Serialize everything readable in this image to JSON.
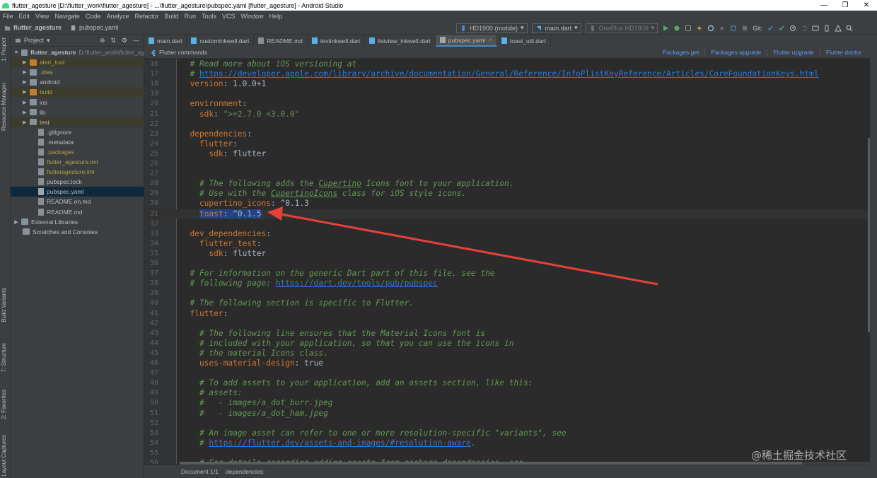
{
  "window": {
    "title": "flutter_agesture [D:\\flutter_work\\flutter_agesture] - ...\\flutter_agesture\\pubspec.yaml [flutter_agesture] - Android Studio"
  },
  "menu": [
    "File",
    "Edit",
    "View",
    "Navigate",
    "Code",
    "Analyze",
    "Refactor",
    "Build",
    "Run",
    "Tools",
    "VCS",
    "Window",
    "Help"
  ],
  "breadcrumb": {
    "project": "flutter_agesture",
    "file": "pubspec.yaml"
  },
  "toolbar": {
    "device_config": "HD1900 (mobile)",
    "run_config": "main.dart",
    "device": "OnePlus HD1900",
    "git_label": "Git:"
  },
  "left_strip": {
    "project": "1: Project",
    "resource_manager": "Resource Manager",
    "build_variants": "Build Variants",
    "structure": "7: Structure",
    "favorites": "2: Favorites",
    "layout_captures": "Layout Captures"
  },
  "project_panel": {
    "title": "Project",
    "tree": [
      {
        "label": "flutter_agesture",
        "path": "D:\\flutter_work\\flutter_ag",
        "indent": 0,
        "arrow": "▼",
        "icon": "folder",
        "bold": true
      },
      {
        "label": "alert_tool",
        "indent": 1,
        "arrow": "▶",
        "icon": "folder-orange",
        "olive": true,
        "hl": true
      },
      {
        "label": ".idea",
        "indent": 1,
        "arrow": "▶",
        "icon": "folder",
        "olive": true
      },
      {
        "label": "android",
        "indent": 1,
        "arrow": "▶",
        "icon": "folder"
      },
      {
        "label": "build",
        "indent": 1,
        "arrow": "▶",
        "icon": "folder-orange",
        "olive": true,
        "hl": true
      },
      {
        "label": "ios",
        "indent": 1,
        "arrow": "▶",
        "icon": "folder"
      },
      {
        "label": "lib",
        "indent": 1,
        "arrow": "▶",
        "icon": "folder"
      },
      {
        "label": "test",
        "indent": 1,
        "arrow": "▶",
        "icon": "folder",
        "hl": true
      },
      {
        "label": ".gitignore",
        "indent": 2,
        "icon": "file"
      },
      {
        "label": ".metadata",
        "indent": 2,
        "icon": "file"
      },
      {
        "label": ".packages",
        "indent": 2,
        "icon": "file",
        "olive": true
      },
      {
        "label": "flutter_agesture.iml",
        "indent": 2,
        "icon": "file",
        "olive": true
      },
      {
        "label": "flutteragesture.iml",
        "indent": 2,
        "icon": "file",
        "olive": true
      },
      {
        "label": "pubspec.lock",
        "indent": 2,
        "icon": "file"
      },
      {
        "label": "pubspec.yaml",
        "indent": 2,
        "icon": "file-yaml",
        "selected": true
      },
      {
        "label": "README.en.md",
        "indent": 2,
        "icon": "file"
      },
      {
        "label": "README.md",
        "indent": 2,
        "icon": "file"
      },
      {
        "label": "External Libraries",
        "indent": 0,
        "arrow": "▶",
        "icon": "folder"
      },
      {
        "label": "Scratches and Consoles",
        "indent": 0,
        "icon": "folder"
      }
    ]
  },
  "tabs": [
    {
      "label": "main.dart"
    },
    {
      "label": "custominkwell.dart"
    },
    {
      "label": "README.md"
    },
    {
      "label": "textinkwell.dart"
    },
    {
      "label": "listview_inkwell.dart"
    },
    {
      "label": "pubspec.yaml",
      "active": true
    },
    {
      "label": "toast_util.dart"
    }
  ],
  "flutter_commands": {
    "title": "Flutter commands",
    "links": [
      "Packages get",
      "Packages upgrade",
      "Flutter upgrade",
      "Flutter doctor"
    ]
  },
  "editor": {
    "lines": [
      {
        "n": "16",
        "parts": [
          {
            "t": "  # Read more about iOS versioning at",
            "c": "c"
          }
        ]
      },
      {
        "n": "17",
        "parts": [
          {
            "t": "  # ",
            "c": "c"
          },
          {
            "t": "https://developer.apple.com/library/archive/documentation/General/Reference/InfoPlistKeyReference/Articles/CoreFoundationKeys.html",
            "c": "u"
          }
        ]
      },
      {
        "n": "18",
        "parts": [
          {
            "t": "  version",
            "c": "k"
          },
          {
            "t": ": 1.0.0+1",
            "c": "v"
          }
        ]
      },
      {
        "n": "19",
        "parts": []
      },
      {
        "n": "20",
        "parts": [
          {
            "t": "  environment",
            "c": "k"
          },
          {
            "t": ":",
            "c": "v"
          }
        ]
      },
      {
        "n": "21",
        "parts": [
          {
            "t": "    sdk",
            "c": "k"
          },
          {
            "t": ": ",
            "c": "v"
          },
          {
            "t": "\">=2.7.0 <3.0.0\"",
            "c": "s"
          }
        ]
      },
      {
        "n": "22",
        "parts": []
      },
      {
        "n": "23",
        "parts": [
          {
            "t": "  dependencies",
            "c": "k"
          },
          {
            "t": ":",
            "c": "v"
          }
        ]
      },
      {
        "n": "24",
        "parts": [
          {
            "t": "    flutter",
            "c": "k"
          },
          {
            "t": ":",
            "c": "v"
          }
        ]
      },
      {
        "n": "25",
        "parts": [
          {
            "t": "      sdk",
            "c": "k"
          },
          {
            "t": ": flutter",
            "c": "v"
          }
        ]
      },
      {
        "n": "26",
        "parts": []
      },
      {
        "n": "27",
        "parts": []
      },
      {
        "n": "28",
        "parts": [
          {
            "t": "    # The following adds the ",
            "c": "c"
          },
          {
            "t": "Cupertino",
            "c": "cu"
          },
          {
            "t": " Icons font to your application.",
            "c": "c"
          }
        ]
      },
      {
        "n": "29",
        "parts": [
          {
            "t": "    # Use with the ",
            "c": "c"
          },
          {
            "t": "CupertinoIcons",
            "c": "cu"
          },
          {
            "t": " class for iOS style icons.",
            "c": "c"
          }
        ]
      },
      {
        "n": "30",
        "parts": [
          {
            "t": "    cupertino_icons",
            "c": "k"
          },
          {
            "t": ": ^0.1.3",
            "c": "v"
          }
        ]
      },
      {
        "n": "31",
        "current": true,
        "parts": [
          {
            "t": "    ",
            "c": "v"
          },
          {
            "t": "toast",
            "c": "ks"
          },
          {
            "t": ": ^0.1.5",
            "c": "vs"
          }
        ]
      },
      {
        "n": "32",
        "parts": []
      },
      {
        "n": "33",
        "parts": [
          {
            "t": "  dev_dependencies",
            "c": "k"
          },
          {
            "t": ":",
            "c": "v"
          }
        ]
      },
      {
        "n": "34",
        "parts": [
          {
            "t": "    flutter_test",
            "c": "k"
          },
          {
            "t": ":",
            "c": "v"
          }
        ]
      },
      {
        "n": "35",
        "parts": [
          {
            "t": "      sdk",
            "c": "k"
          },
          {
            "t": ": flutter",
            "c": "v"
          }
        ]
      },
      {
        "n": "36",
        "parts": []
      },
      {
        "n": "37",
        "parts": [
          {
            "t": "  # For information on the generic Dart part of this file, see the",
            "c": "c"
          }
        ]
      },
      {
        "n": "38",
        "parts": [
          {
            "t": "  # following page: ",
            "c": "c"
          },
          {
            "t": "https://dart.dev/tools/pub/pubspec",
            "c": "u"
          }
        ]
      },
      {
        "n": "39",
        "parts": []
      },
      {
        "n": "40",
        "parts": [
          {
            "t": "  # The following section is specific to Flutter.",
            "c": "c"
          }
        ]
      },
      {
        "n": "41",
        "parts": [
          {
            "t": "  flutter",
            "c": "k"
          },
          {
            "t": ":",
            "c": "v"
          }
        ]
      },
      {
        "n": "42",
        "parts": []
      },
      {
        "n": "43",
        "parts": [
          {
            "t": "    # The following line ensures that the Material Icons font is",
            "c": "c"
          }
        ]
      },
      {
        "n": "44",
        "parts": [
          {
            "t": "    # included with your application, so that you can use the icons in",
            "c": "c"
          }
        ]
      },
      {
        "n": "45",
        "parts": [
          {
            "t": "    # the material Icons class.",
            "c": "c"
          }
        ]
      },
      {
        "n": "46",
        "parts": [
          {
            "t": "    uses-material-design",
            "c": "k"
          },
          {
            "t": ": true",
            "c": "v"
          }
        ]
      },
      {
        "n": "47",
        "parts": []
      },
      {
        "n": "48",
        "parts": [
          {
            "t": "    # To add assets to your application, add an assets section, like this:",
            "c": "c"
          }
        ]
      },
      {
        "n": "49",
        "parts": [
          {
            "t": "    # assets:",
            "c": "c"
          }
        ]
      },
      {
        "n": "50",
        "parts": [
          {
            "t": "    #   - images/a_dot_burr.jpeg",
            "c": "c"
          }
        ]
      },
      {
        "n": "51",
        "parts": [
          {
            "t": "    #   - images/a_dot_ham.jpeg",
            "c": "c"
          }
        ]
      },
      {
        "n": "52",
        "parts": []
      },
      {
        "n": "53",
        "parts": [
          {
            "t": "    # An image asset can refer to one or more resolution-specific \"variants\", see",
            "c": "c"
          }
        ]
      },
      {
        "n": "54",
        "parts": [
          {
            "t": "    # ",
            "c": "c"
          },
          {
            "t": "https://flutter.dev/assets-and-images/#resolution-aware",
            "c": "u"
          },
          {
            "t": ".",
            "c": "c"
          }
        ]
      },
      {
        "n": "55",
        "parts": []
      },
      {
        "n": "56",
        "parts": [
          {
            "t": "    # For details regarding adding assets from package dependencies, see",
            "c": "c"
          }
        ]
      }
    ]
  },
  "status": {
    "document": "Document 1/1",
    "context": "dependencies:"
  },
  "watermark": "@稀土掘金技术社区",
  "colors": {
    "accent": "#4a88c7",
    "arrow": "#e8403b",
    "selection": "#214283"
  }
}
